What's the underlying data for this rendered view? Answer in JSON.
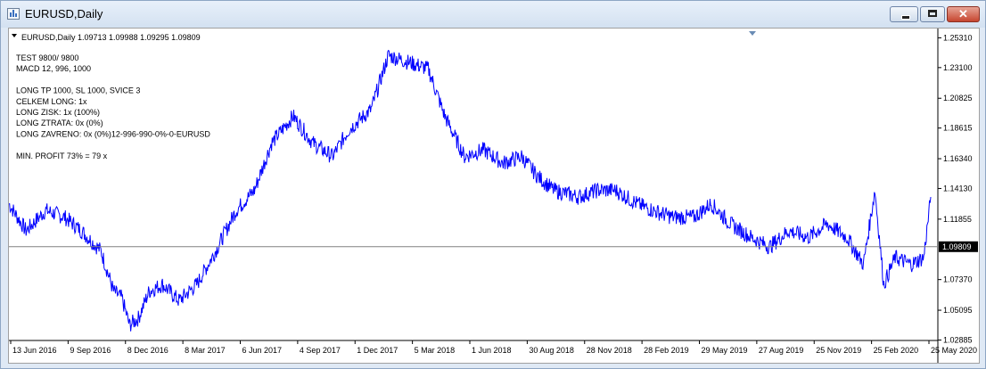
{
  "window": {
    "title": "EURUSD,Daily"
  },
  "chart_header": "EURUSD,Daily  1.09713 1.09988 1.09295 1.09809",
  "info_lines": [
    "TEST 9800/ 9800",
    "MACD 12, 996, 1000",
    "",
    "LONG TP 1000, SL 1000, SVICE 3",
    "CELKEM LONG: 1x",
    "LONG ZISK: 1x (100%)",
    "LONG ZTRATA: 0x (0%)",
    "LONG ZAVRENO: 0x (0%)12-996-990-0%-0-EURUSD",
    "",
    "MIN. PROFIT 73% = 79 x"
  ],
  "chart_data": {
    "type": "line",
    "symbol": "EURUSD",
    "timeframe": "Daily",
    "ohlc": {
      "open": 1.09713,
      "high": 1.09988,
      "low": 1.09295,
      "close": 1.09809
    },
    "current_price": 1.09809,
    "ylim": [
      1.0285,
      1.26
    ],
    "y_ticks": [
      "1.25310",
      "1.23100",
      "1.20825",
      "1.18615",
      "1.16340",
      "1.14130",
      "1.11855",
      "1.09809",
      "1.07370",
      "1.05095",
      "1.02885"
    ],
    "x_ticks": [
      "13 Jun 2016",
      "9 Sep 2016",
      "8 Dec 2016",
      "8 Mar 2017",
      "6 Jun 2017",
      "4 Sep 2017",
      "1 Dec 2017",
      "5 Mar 2018",
      "1 Jun 2018",
      "30 Aug 2018",
      "28 Nov 2018",
      "28 Feb 2019",
      "29 May 2019",
      "27 Aug 2019",
      "25 Nov 2019",
      "25 Feb 2020",
      "25 May 2020"
    ],
    "series": [
      {
        "color": "#0000ff",
        "x": [
          "2016-06-13",
          "2016-07-10",
          "2016-08-10",
          "2016-09-09",
          "2016-10-05",
          "2016-11-05",
          "2016-11-25",
          "2016-12-08",
          "2016-12-20",
          "2017-01-03",
          "2017-01-20",
          "2017-02-10",
          "2017-03-08",
          "2017-04-05",
          "2017-05-05",
          "2017-06-06",
          "2017-07-05",
          "2017-08-01",
          "2017-09-04",
          "2017-10-05",
          "2017-11-05",
          "2017-12-01",
          "2018-01-05",
          "2018-02-01",
          "2018-03-05",
          "2018-04-05",
          "2018-05-01",
          "2018-06-01",
          "2018-07-01",
          "2018-08-01",
          "2018-08-30",
          "2018-09-25",
          "2018-10-20",
          "2018-11-28",
          "2018-12-28",
          "2019-01-25",
          "2019-02-28",
          "2019-03-25",
          "2019-04-25",
          "2019-05-29",
          "2019-06-25",
          "2019-07-25",
          "2019-08-27",
          "2019-09-25",
          "2019-10-25",
          "2019-11-25",
          "2019-12-25",
          "2020-01-25",
          "2020-02-20",
          "2020-03-09",
          "2020-03-23",
          "2020-04-10",
          "2020-05-05",
          "2020-05-25",
          "2020-06-05"
        ],
        "y": [
          1.13,
          1.11,
          1.125,
          1.12,
          1.11,
          1.095,
          1.065,
          1.06,
          1.04,
          1.045,
          1.065,
          1.07,
          1.058,
          1.07,
          1.095,
          1.125,
          1.14,
          1.175,
          1.195,
          1.175,
          1.165,
          1.185,
          1.2,
          1.24,
          1.235,
          1.23,
          1.195,
          1.165,
          1.17,
          1.16,
          1.165,
          1.15,
          1.14,
          1.135,
          1.14,
          1.14,
          1.13,
          1.125,
          1.12,
          1.12,
          1.13,
          1.115,
          1.105,
          1.098,
          1.11,
          1.105,
          1.115,
          1.105,
          1.085,
          1.14,
          1.07,
          1.09,
          1.085,
          1.09,
          1.135
        ]
      }
    ]
  }
}
